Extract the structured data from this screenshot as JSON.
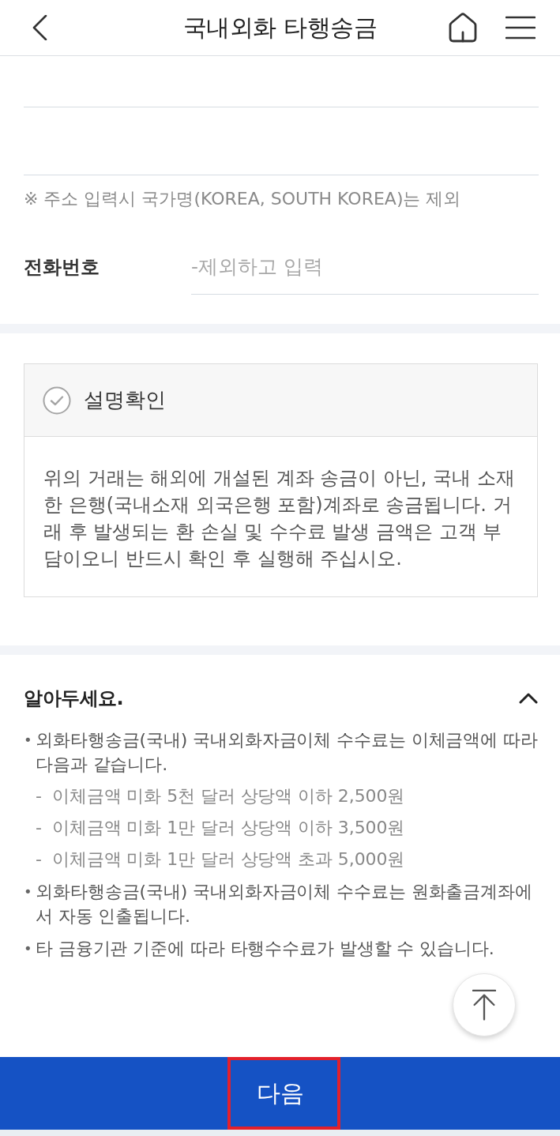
{
  "header": {
    "title": "국내외화 타행송금"
  },
  "address": {
    "note": "※ 주소 입력시 국가명(KOREA, SOUTH KOREA)는 제외"
  },
  "phone": {
    "label": "전화번호",
    "placeholder": "-제외하고 입력"
  },
  "confirmation": {
    "title": "설명확인",
    "checked": false,
    "text": "위의 거래는 해외에 개설된 계좌 송금이 아닌, 국내 소재한 은행(국내소재 외국은행 포함)계좌로 송금됩니다. 거래 후 발생되는 환 손실 및 수수료 발생 금액은 고객 부담이오니 반드시 확인 후 실행해 주십시오."
  },
  "notice": {
    "title": "알아두세요.",
    "expanded": true,
    "items": [
      {
        "marker": "•",
        "text": "외화타행송금(국내) 국내외화자금이체 수수료는 이체금액에 따라 다음과 같습니다.",
        "children": [
          {
            "marker": "-",
            "text": "이체금액 미화 5천 달러 상당액 이하 2,500원"
          },
          {
            "marker": "-",
            "text": "이체금액 미화 1만 달러 상당액 이하 3,500원"
          },
          {
            "marker": "-",
            "text": "이체금액 미화 1만 달러 상당액 초과 5,000원"
          }
        ]
      },
      {
        "marker": "•",
        "text": "외화타행송금(국내) 국내외화자금이체 수수료는 원화출금계좌에서 자동 인출됩니다."
      },
      {
        "marker": "•",
        "text": "타 금융기관 기준에 따라 타행수수료가 발생할 수 있습니다."
      }
    ]
  },
  "next_button": {
    "label": "다음",
    "highlighted": true
  }
}
